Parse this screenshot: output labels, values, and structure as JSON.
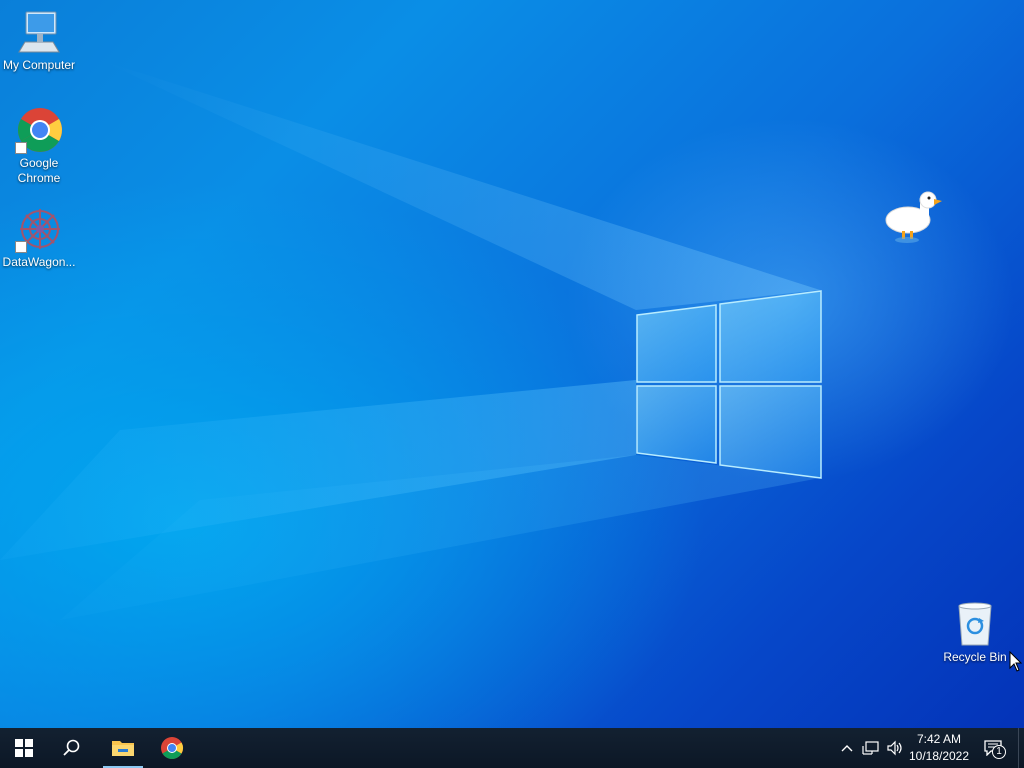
{
  "desktop": {
    "icons": [
      {
        "label": "My Computer",
        "icon": "computer-icon"
      },
      {
        "label": "Google Chrome",
        "icon": "chrome-icon",
        "shortcut": true
      },
      {
        "label": "DataWagon...",
        "icon": "datawagon-icon",
        "shortcut": true
      },
      {
        "label": "Recycle Bin",
        "icon": "recycle-bin-icon"
      }
    ]
  },
  "taskbar": {
    "items": [
      {
        "name": "start",
        "icon": "windows-start-icon"
      },
      {
        "name": "search",
        "icon": "search-icon"
      },
      {
        "name": "file-explorer",
        "icon": "folder-icon",
        "active": true
      },
      {
        "name": "chrome",
        "icon": "chrome-icon"
      }
    ],
    "tray": {
      "icons": [
        "chevron-up-icon",
        "network-icon",
        "volume-icon",
        "notification-icon"
      ],
      "time": "7:42 AM",
      "date": "10/18/2022",
      "notification_count": "1"
    }
  },
  "colors": {
    "taskbar_bg": "#0f1b2b",
    "desktop_blue": "#0a7fd9",
    "accent": "#8cc8f2"
  }
}
